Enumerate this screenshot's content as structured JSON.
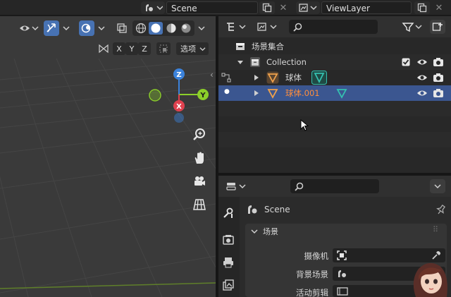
{
  "topbar": {
    "scene_name": "Scene",
    "view_layer_name": "ViewLayer"
  },
  "viewport": {
    "axes": {
      "x": "X",
      "y": "Y",
      "z": "Z"
    },
    "options_label": "选项",
    "colors": {
      "x_axis": "#e0414f",
      "y_axis": "#8ccf2a",
      "z_axis": "#3b82db",
      "background": "#3a3a3a"
    }
  },
  "outliner": {
    "search_placeholder": "",
    "items": [
      {
        "label": "场景集合"
      },
      {
        "label": "Collection"
      },
      {
        "label": "球体"
      },
      {
        "label": "球体.001"
      }
    ],
    "colors": {
      "selected_row": "#3b5690",
      "active_text": "#ff8e3c",
      "mesh_icon": "#f0a14b",
      "data_icon": "#35c0b0"
    }
  },
  "properties": {
    "search_placeholder": "",
    "scene_title": "Scene",
    "panel_title": "场景",
    "fields": [
      {
        "label": "摄像机"
      },
      {
        "label": "背景场景"
      },
      {
        "label": "活动剪辑"
      }
    ]
  }
}
